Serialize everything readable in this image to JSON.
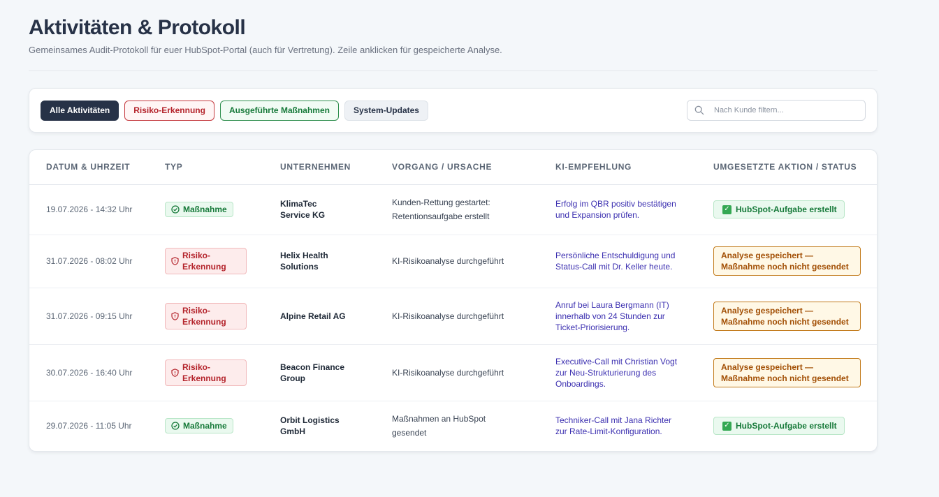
{
  "page": {
    "title": "Aktivitäten & Protokoll",
    "subtitle": "Gemeinsames Audit-Protokoll für euer HubSpot-Portal (auch für Vertretung). Zeile anklicken für gespeicherte Analyse."
  },
  "filters": {
    "all_label": "Alle Aktivitäten",
    "risk_label": "Risiko-Erkennung",
    "done_label": "Ausgeführte Maßnahmen",
    "system_label": "System-Updates",
    "active": "all",
    "search_placeholder": "Nach Kunde filtern...",
    "search_value": ""
  },
  "table": {
    "headers": {
      "date": "Datum & Uhrzeit",
      "type": "Typ",
      "company": "Unternehmen",
      "cause": "Vorgang / Ursache",
      "recommendation": "KI-Empfehlung",
      "status": "Umgesetzte Aktion / Status"
    },
    "rows": [
      {
        "date": "19.07.2026 - 14:32 Uhr",
        "type": "Maßnahme",
        "company": "KlimaTec Service KG",
        "cause": "Kunden-Rettung gestartet: Retentionsaufgabe erstellt",
        "recommendation": "Erfolg im QBR positiv bestätigen und Expansion prüfen.",
        "status": "HubSpot-Aufgabe erstellt"
      },
      {
        "date": "31.07.2026 - 08:02 Uhr",
        "type": "Risiko-Erkennung",
        "company": "Helix Health Solutions",
        "cause": "KI-Risikoanalyse durchgeführt",
        "recommendation": "Persönliche Entschuldigung und Status-Call mit Dr. Keller heute.",
        "status": "Analyse gespeichert — Maßnahme noch nicht gesendet"
      },
      {
        "date": "31.07.2026 - 09:15 Uhr",
        "type": "Risiko-Erkennung",
        "company": "Alpine Retail AG",
        "cause": "KI-Risikoanalyse durchgeführt",
        "recommendation": "Anruf bei Laura Bergmann (IT) innerhalb von 24 Stunden zur Ticket-Priorisierung.",
        "status": "Analyse gespeichert — Maßnahme noch nicht gesendet"
      },
      {
        "date": "30.07.2026 - 16:40 Uhr",
        "type": "Risiko-Erkennung",
        "company": "Beacon Finance Group",
        "cause": "KI-Risikoanalyse durchgeführt",
        "recommendation": "Executive-Call mit Christian Vogt zur Neu-Strukturierung des Onboardings.",
        "status": "Analyse gespeichert — Maßnahme noch nicht gesendet"
      },
      {
        "date": "29.07.2026 - 11:05 Uhr",
        "type": "Maßnahme",
        "company": "Orbit Logistics GmbH",
        "cause": "Maßnahmen an HubSpot gesendet",
        "recommendation": "Techniker-Call mit Jana Richter zur Rate-Limit-Konfiguration.",
        "status": "HubSpot-Aufgabe erstellt"
      }
    ]
  }
}
